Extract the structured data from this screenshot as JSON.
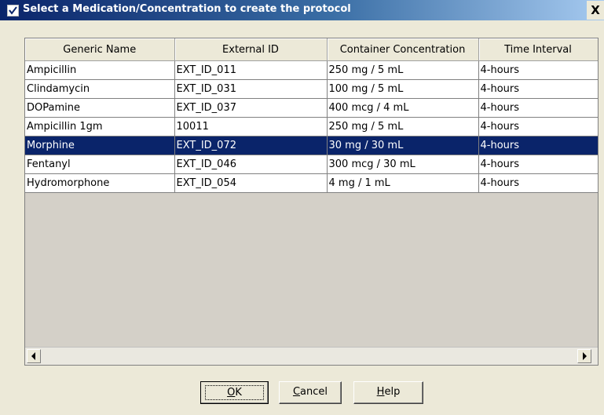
{
  "window": {
    "title": "Select a Medication/Concentration to create the protocol",
    "close_label": "X"
  },
  "table": {
    "columns": [
      "Generic Name",
      "External ID",
      "Container Concentration",
      "Time Interval"
    ],
    "rows": [
      [
        "Ampicillin",
        "EXT_ID_011",
        "250 mg / 5 mL",
        "4-hours"
      ],
      [
        "Clindamycin",
        "EXT_ID_031",
        "100 mg / 5 mL",
        "4-hours"
      ],
      [
        "DOPamine",
        "EXT_ID_037",
        "400 mcg / 4 mL",
        "4-hours"
      ],
      [
        "Ampicillin 1gm",
        "10011",
        "250 mg / 5 mL",
        "4-hours"
      ],
      [
        "Morphine",
        "EXT_ID_072",
        "30 mg / 30 mL",
        "4-hours"
      ],
      [
        "Fentanyl",
        "EXT_ID_046",
        "300 mcg / 30 mL",
        "4-hours"
      ],
      [
        "Hydromorphone",
        "EXT_ID_054",
        "4 mg / 1 mL",
        "4-hours"
      ]
    ],
    "selected_row": 4
  },
  "buttons": {
    "ok": {
      "mnemonic": "O",
      "rest": "K"
    },
    "cancel": {
      "mnemonic": "C",
      "rest": "ancel"
    },
    "help": {
      "mnemonic": "H",
      "rest": "elp"
    }
  },
  "icons": {
    "title": "checkbox-check-icon",
    "scroll_left": "arrow-left-icon",
    "scroll_right": "arrow-right-icon"
  },
  "colors": {
    "selection": "#0a246a",
    "title_gradient_start": "#0a246a",
    "title_gradient_end": "#a6caf0"
  }
}
